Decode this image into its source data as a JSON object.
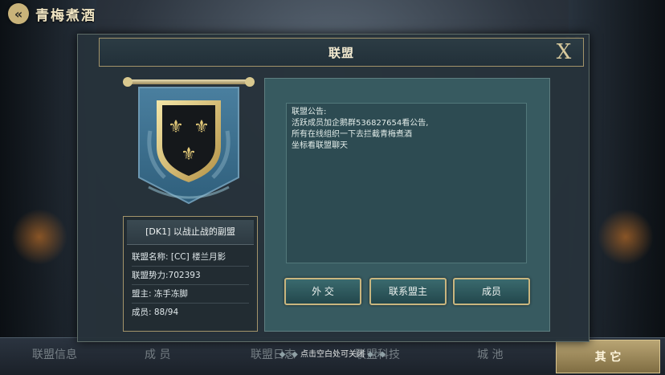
{
  "top": {
    "title": "青梅煮酒",
    "back_glyph": "«"
  },
  "dialog": {
    "title": "联盟",
    "close_glyph": "X"
  },
  "alliance": {
    "name": "[DK1] 以战止战的副盟",
    "rows": [
      "联盟名称: [CC] 楼兰月影",
      "联盟势力:702393",
      "盟主: 冻手冻脚",
      "成员: 88/94"
    ]
  },
  "notice": {
    "lines": [
      "联盟公告:",
      "活跃成员加企鹅群536827654看公告,",
      "所有在线组织一下去拦截青梅煮酒",
      "坐标看联盟聊天"
    ]
  },
  "buttons": {
    "diplomacy": "外 交",
    "contact": "联系盟主",
    "members": "成员"
  },
  "bottom_tabs": [
    "联盟信息",
    "成 员",
    "联盟日志",
    "联盟科技",
    "城 池",
    "其 它"
  ],
  "hint": "点击空白处可关闭",
  "colors": {
    "accent_gold": "#c9b67f",
    "panel_teal": "#375a60",
    "banner_blue": "#3d6f90"
  },
  "icons": [
    "back-arrow-icon",
    "close-icon",
    "fleur-de-lis-icon"
  ]
}
